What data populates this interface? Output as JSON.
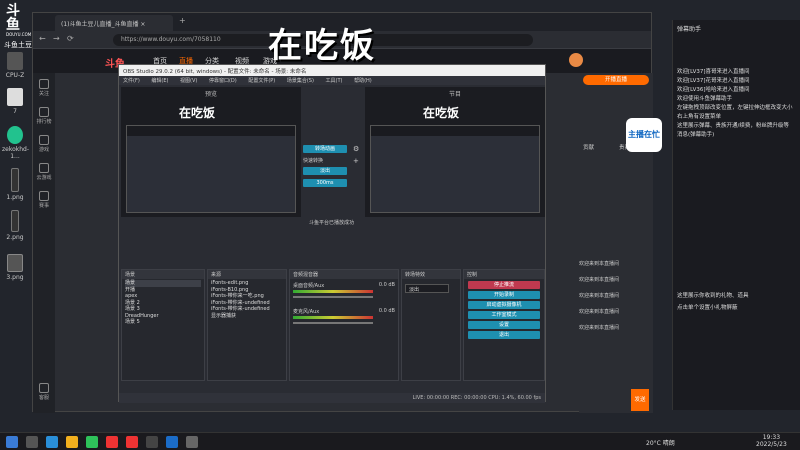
{
  "desktop": {
    "icons": [
      {
        "label": "CPU-Z"
      },
      {
        "label": "7"
      },
      {
        "label": "zekokhd-1..."
      },
      {
        "label": "1.png"
      },
      {
        "label": "2.png"
      },
      {
        "label": "3.png"
      }
    ],
    "top_left_logo": "斗鱼",
    "top_left_sub": "DOUYU.COM",
    "top_left_caption": "斗鱼土豆儿"
  },
  "browser": {
    "tab_title": "(1)斗鱼土豆儿直播_斗鱼直播 ×",
    "url": "https://www.douyu.com/7058110",
    "site_logo": "斗鱼",
    "nav": [
      "首页",
      "直播",
      "分类",
      "视频",
      "游戏"
    ],
    "active_nav": "直播",
    "left_nav": [
      "关注",
      "排行榜",
      "游戏",
      "云游戏",
      "赛事",
      "客服"
    ]
  },
  "overlay_text": "在吃饭",
  "obs": {
    "title": "OBS Studio 29.0.2 (64 bit, windows) - 配置文件: 未命名 - 场景: 未命名",
    "menu": [
      "文件(F)",
      "编辑(E)",
      "视图(V)",
      "停靠窗口(D)",
      "配置文件(P)",
      "场景集合(S)",
      "工具(T)",
      "帮助(H)"
    ],
    "preview_label": "预览",
    "program_label": "节目",
    "transition_buttons": [
      "转场动画",
      "快速转换",
      "淡出",
      "300ms"
    ],
    "transition_hint": "斗鱼平台已播放成功",
    "scenes_header": "场景",
    "scenes": [
      "场景",
      "开播",
      "apex",
      "场景 2",
      "场景 3",
      "DreadHunger",
      "场景 5"
    ],
    "sources_header": "来源",
    "sources": [
      "iFonts-edit.png",
      "iFonts-B10.png",
      "iFonts-带你来一吃.png",
      "iFonts-带你来-undefined",
      "iFonts-带你来-undefined",
      "显示器捕获"
    ],
    "mixer_header": "音频混音器",
    "mixer": [
      {
        "label": "桌面音频/Aux",
        "db": "0.0 dB"
      },
      {
        "label": "麦克风/Aux",
        "db": "0.0 dB"
      }
    ],
    "transitions_header": "转场特效",
    "transition_type": "淡出",
    "controls_header": "控制",
    "controls": [
      "停止推流",
      "开始录制",
      "启动虚拟摄像机",
      "工作室模式",
      "设置",
      "退出"
    ],
    "status": "LIVE: 00:00:00   REC: 00:00:00   CPU: 1.4%, 60.00 fps"
  },
  "chat": {
    "tabs": [
      "贡献",
      "贵宾"
    ],
    "lines": [
      "欢迎来到本直播间",
      "欢迎来到本直播间",
      "欢迎来到本直播间",
      "欢迎来到本直播间",
      "欢迎来到本直播间"
    ],
    "send_label": "发送",
    "live_button": "开播直播"
  },
  "right_panel": {
    "header": "弹幕助手",
    "lines": [
      "欢迎[LV37]喜哥来进入直播间",
      "欢迎[LV37]花哥来进入直播间",
      "欢迎[LV36]哈哈来进入直播间",
      "欢迎使用斗鱼弹幕助手",
      "左键拖拽顶部改变位置，左键拉伸边框改变大小",
      "右上角有设置菜单",
      "这里展示弹幕、贵族开通/续费，粉丝牌升级等",
      "消息(弹幕助手)"
    ],
    "footer_line1": "这里展示你收到的礼物、道具",
    "footer_line2": "点击单个设置小礼物屏蔽"
  },
  "sticker_text": "主播在忙",
  "taskbar": {
    "weather": "20°C 晴朗",
    "time": "19:33",
    "date": "2022/5/23"
  },
  "colors": {
    "accent": "#ff6a00",
    "obs_blue": "#1e8fb0",
    "obs_red": "#c0394f"
  }
}
